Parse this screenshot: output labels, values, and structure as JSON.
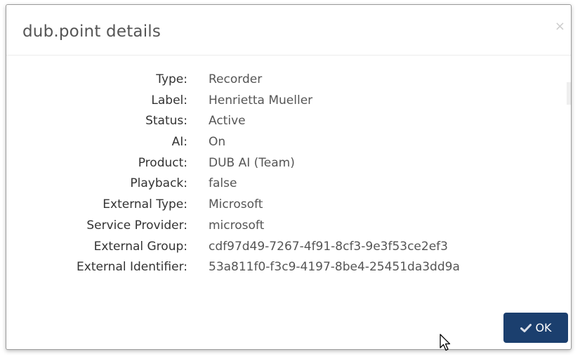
{
  "dialog": {
    "title": "dub.point details",
    "close_glyph": "×",
    "ok_label": "OK",
    "ok_icon": "checkmark-icon",
    "accent_color": "#1b3f6e"
  },
  "details": [
    {
      "label": "Type:",
      "value": "Recorder"
    },
    {
      "label": "Label:",
      "value": "Henrietta Mueller"
    },
    {
      "label": "Status:",
      "value": "Active"
    },
    {
      "label": "AI:",
      "value": "On"
    },
    {
      "label": "Product:",
      "value": "DUB AI (Team)"
    },
    {
      "label": "Playback:",
      "value": "false"
    },
    {
      "label": "External Type:",
      "value": "Microsoft"
    },
    {
      "label": "Service Provider:",
      "value": "microsoft"
    },
    {
      "label": "External Group:",
      "value": "cdf97d49-7267-4f91-8cf3-9e3f53ce2ef3"
    },
    {
      "label": "External Identifier:",
      "value": "53a811f0-f3c9-4197-8be4-25451da3dd9a"
    }
  ]
}
